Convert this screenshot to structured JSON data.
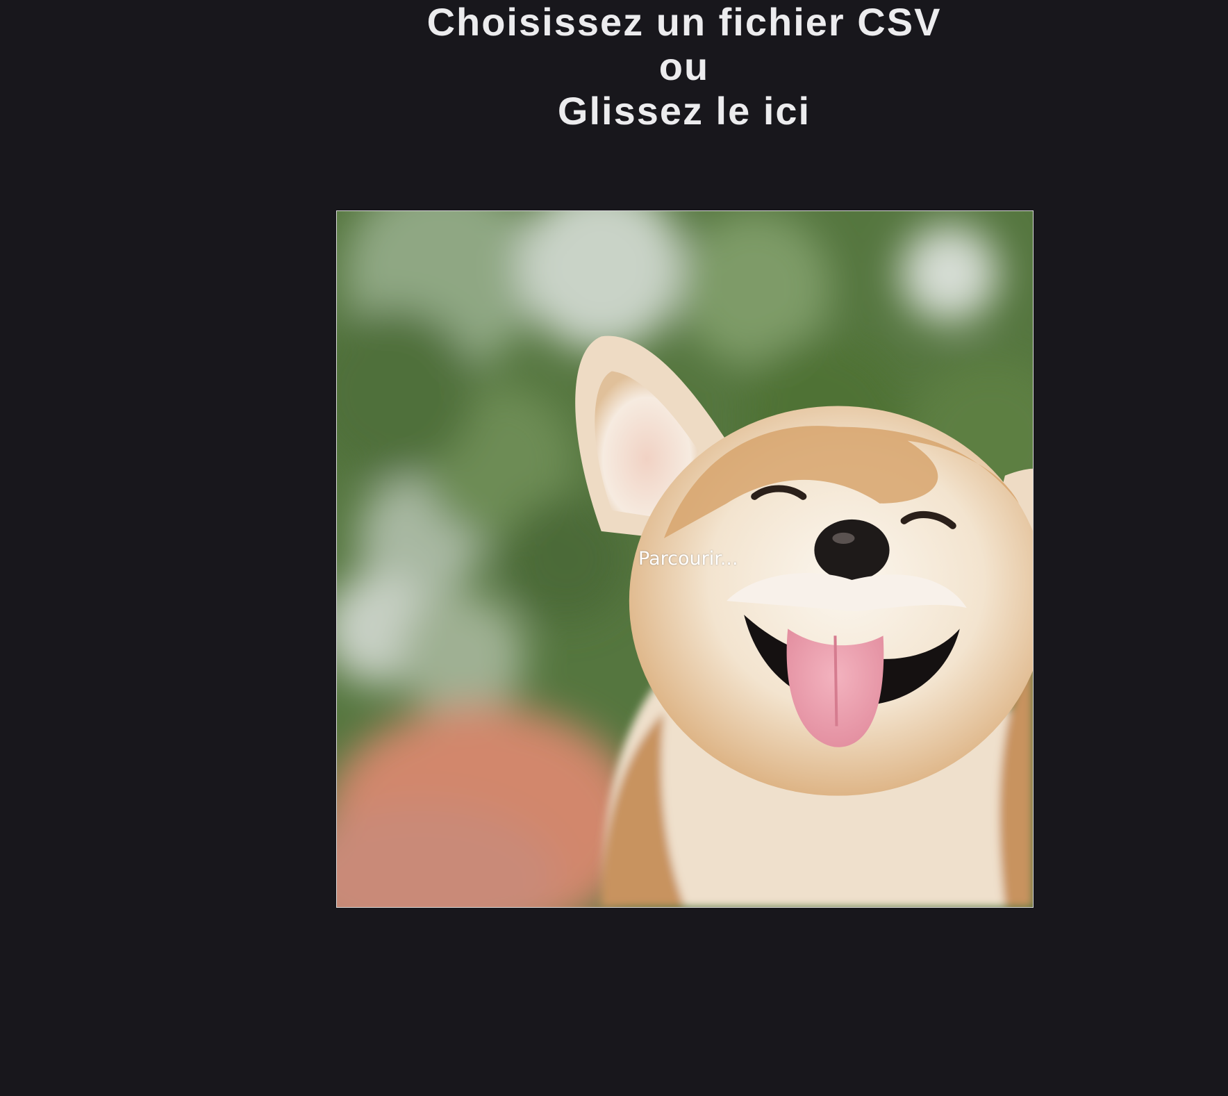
{
  "upload": {
    "title_line1": "Choisissez un fichier CSV",
    "title_line2": "ou",
    "title_line3": "Glissez le ici",
    "browse_label": "Parcourir...",
    "accept": ".csv"
  },
  "colors": {
    "background": "#18171c",
    "heading_text": "#ececee",
    "dropzone_border": "#d9d9d9"
  },
  "icons": {
    "preview": "corgi-photo"
  }
}
